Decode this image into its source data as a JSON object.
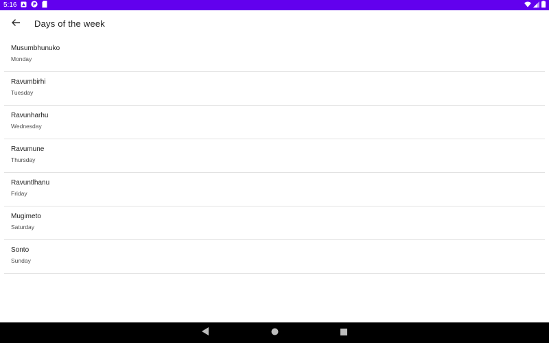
{
  "status_bar": {
    "time": "5:16",
    "left_icons": [
      "photo-notification-icon",
      "app-notification-icon",
      "sd-card-icon"
    ],
    "right_icons": [
      "wifi-icon",
      "cell-signal-icon",
      "battery-icon"
    ],
    "background_color": "#6200ee"
  },
  "app_bar": {
    "back_icon": "arrow-back-icon",
    "title": "Days of the week"
  },
  "list": {
    "items": [
      {
        "primary": "Musumbhunuko",
        "secondary": "Monday"
      },
      {
        "primary": "Ravumbirhi",
        "secondary": "Tuesday"
      },
      {
        "primary": "Ravunharhu",
        "secondary": "Wednesday"
      },
      {
        "primary": "Ravumune",
        "secondary": "Thursday"
      },
      {
        "primary": "Ravuntlhanu",
        "secondary": "Friday"
      },
      {
        "primary": "Mugimeto",
        "secondary": "Saturday"
      },
      {
        "primary": "Sonto",
        "secondary": "Sunday"
      }
    ]
  },
  "nav_bar": {
    "buttons": [
      "back-triangle-icon",
      "home-circle-icon",
      "recents-square-icon"
    ]
  }
}
